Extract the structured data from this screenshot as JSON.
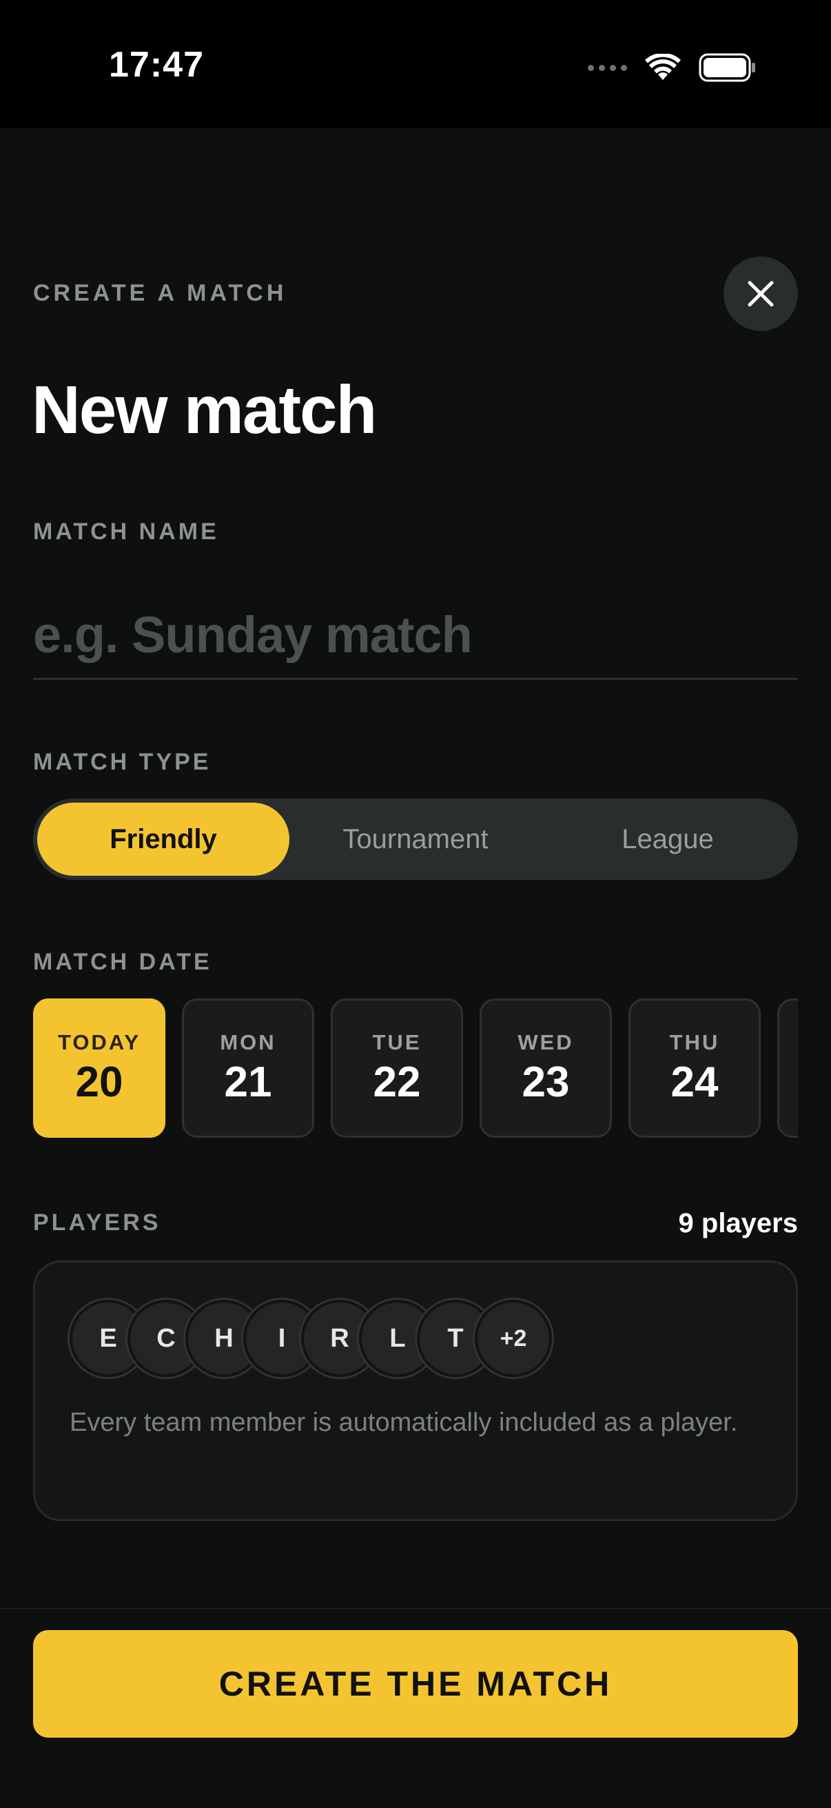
{
  "status_bar": {
    "time": "17:47",
    "icons": [
      "cellular-signal-icon",
      "wifi-icon",
      "battery-icon"
    ]
  },
  "header": {
    "eyebrow": "CREATE A MATCH",
    "title": "New match",
    "close_icon": "close-icon"
  },
  "match_name": {
    "label": "MATCH NAME",
    "value": "",
    "placeholder": "e.g. Sunday match"
  },
  "match_type": {
    "label": "MATCH TYPE",
    "options": [
      "Friendly",
      "Tournament",
      "League"
    ],
    "selected": "Friendly"
  },
  "match_date": {
    "label": "MATCH DATE",
    "days": [
      {
        "dow": "TODAY",
        "num": "20",
        "selected": true
      },
      {
        "dow": "MON",
        "num": "21",
        "selected": false
      },
      {
        "dow": "TUE",
        "num": "22",
        "selected": false
      },
      {
        "dow": "WED",
        "num": "23",
        "selected": false
      },
      {
        "dow": "THU",
        "num": "24",
        "selected": false
      },
      {
        "dow": "",
        "num": "",
        "selected": false
      }
    ]
  },
  "players": {
    "label": "PLAYERS",
    "count": "9 players",
    "avatars": [
      "E",
      "C",
      "H",
      "I",
      "R",
      "L",
      "T",
      "+2"
    ],
    "note": "Every team member is automatically included as a player."
  },
  "cta": {
    "label": "CREATE THE MATCH"
  },
  "colors": {
    "accent": "#f4c430",
    "background": "#0e0f0f",
    "surface": "#2a2d2d",
    "muted_text": "#8d9290"
  }
}
